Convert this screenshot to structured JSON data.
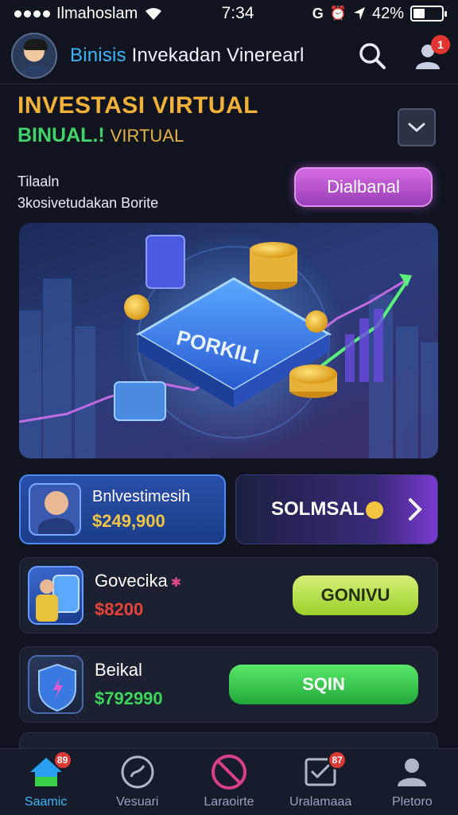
{
  "status_bar": {
    "carrier": "Ilmahoslam",
    "time": "7:34",
    "battery": "42%",
    "battery_level": 0.42
  },
  "header": {
    "brand": "Binisis",
    "title": "Invekadan Vinerearl",
    "notification_count": "1"
  },
  "hero": {
    "title": "INVESTASI VIRTUAL",
    "subtitle_accent": "BINUAL.!",
    "subtitle_muted": "VIRTUAL",
    "desc_line1": "Tilaaln",
    "desc_line2": "3kosivetudakan Borite",
    "cta_label": "Dialbanal"
  },
  "banner": {
    "label": "PORKILI"
  },
  "featured": {
    "name": "Bnlvestimesih",
    "amount": "$249,900",
    "solmsal_label": "SOLMSAL"
  },
  "list": [
    {
      "name": "Govecika",
      "amount": "$8200",
      "amount_color": "#e8433a",
      "button": "GONIVU"
    },
    {
      "name": "Beikal",
      "amount": "$792990",
      "amount_color": "#3fd45a",
      "button": "SQIN"
    }
  ],
  "nav": {
    "items": [
      {
        "label": "Saamic",
        "badge": "89"
      },
      {
        "label": "Vesuari",
        "badge": ""
      },
      {
        "label": "Laraoirte",
        "badge": ""
      },
      {
        "label": "Uralamaaa",
        "badge": "87"
      },
      {
        "label": "Pletoro",
        "badge": ""
      }
    ]
  },
  "colors": {
    "background": "#10141f",
    "accent_blue": "#3ab6ff",
    "gold": "#f4b13a",
    "green": "#42d46a",
    "purple_cta": "#c35ad8"
  }
}
